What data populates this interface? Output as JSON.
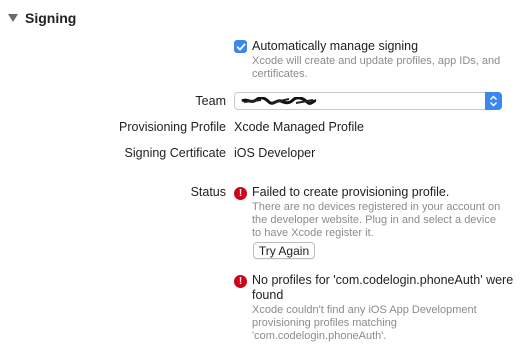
{
  "section": {
    "title": "Signing"
  },
  "auto_signing": {
    "label": "Automatically manage signing",
    "checked": true,
    "description_lines": [
      "Xcode will create and update profiles, app IDs, and",
      "certificates."
    ]
  },
  "team": {
    "label": "Team",
    "value_redacted": true
  },
  "provisioning_profile": {
    "label": "Provisioning Profile",
    "value": "Xcode Managed Profile"
  },
  "signing_certificate": {
    "label": "Signing Certificate",
    "value": "iOS Developer"
  },
  "status": {
    "label": "Status",
    "error1": {
      "title": "Failed to create provisioning profile.",
      "detail_lines": [
        "There are no devices registered in your account on",
        "the developer website. Plug in and select a device",
        "to have Xcode register it."
      ],
      "button": "Try Again"
    },
    "error2": {
      "title_lines": [
        "No profiles for 'com.codelogin.phoneAuth' were",
        "found"
      ],
      "detail_lines": [
        "Xcode couldn't find any iOS App Development",
        "provisioning profiles matching",
        "'com.codelogin.phoneAuth'."
      ]
    }
  },
  "colors": {
    "accent": "#3b87ee",
    "error": "#d0021b",
    "secondary_text": "#8c8c8c"
  },
  "icons": [
    "disclosure-triangle-icon",
    "checkmark-icon",
    "popup-arrows-icon",
    "error-icon"
  ]
}
